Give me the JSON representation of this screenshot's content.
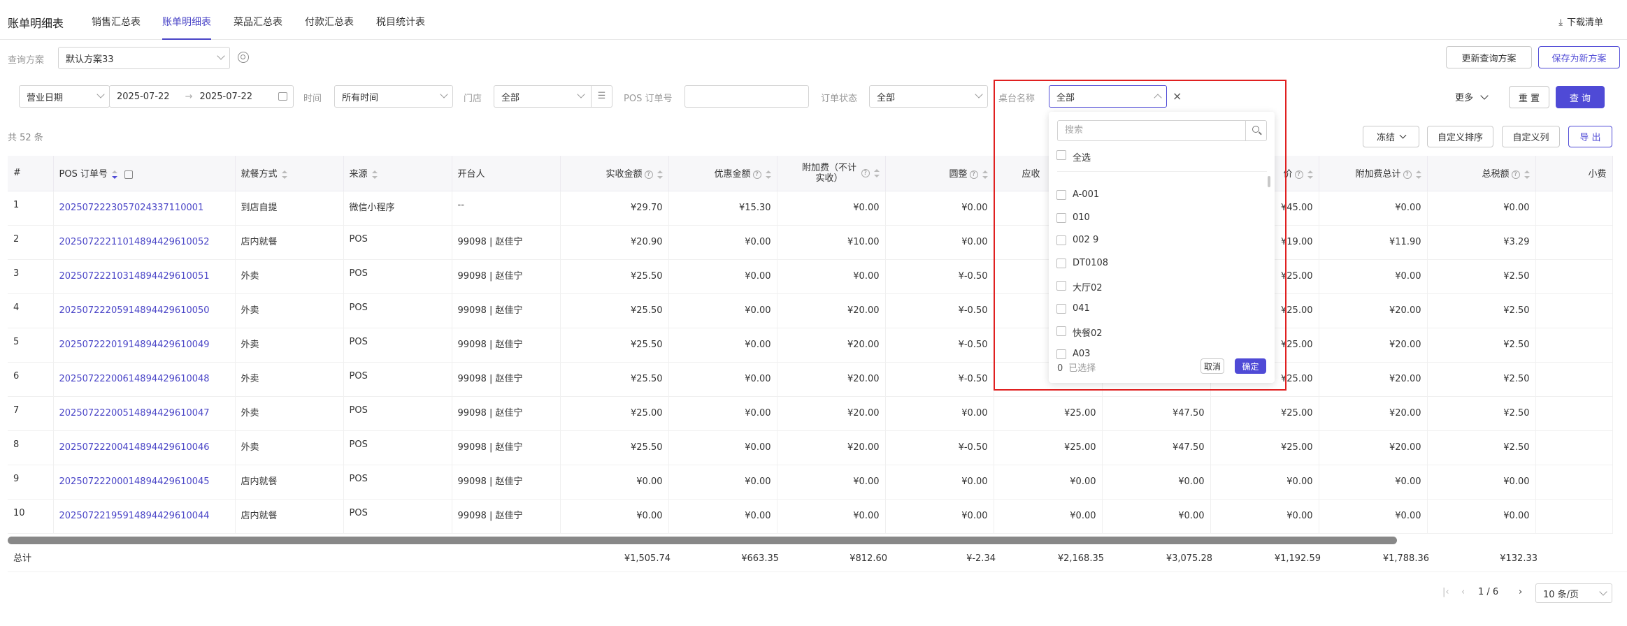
{
  "header": {
    "page_title": "账单明细表",
    "tabs": [
      {
        "label": "销售汇总表"
      },
      {
        "label": "账单明细表"
      },
      {
        "label": "菜品汇总表"
      },
      {
        "label": "付款汇总表"
      },
      {
        "label": "税目统计表"
      }
    ],
    "download_label": "下载清单"
  },
  "query_plan": {
    "label": "查询方案",
    "value": "默认方案33",
    "update_btn": "更新查询方案",
    "save_btn": "保存为新方案"
  },
  "filters": {
    "date_type": "营业日期",
    "date_start": "2025-07-22",
    "date_arrow": "→",
    "date_end": "2025-07-22",
    "time_label": "时间",
    "time_value": "所有时间",
    "store_label": "门店",
    "store_value": "全部",
    "order_label": "POS 订单号",
    "order_placeholder": "",
    "status_label": "订单状态",
    "status_value": "全部",
    "table_label": "桌台名称",
    "table_value": "全部",
    "more": "更多",
    "reset": "重 置",
    "query": "查 询"
  },
  "summary": {
    "count_text": "共 52 条"
  },
  "toolbar": {
    "freeze": "冻结",
    "custom_sort": "自定义排序",
    "custom_cols": "自定义列",
    "export": "导 出"
  },
  "columns": [
    "#",
    "POS 订单号",
    "就餐方式",
    "来源",
    "开台人",
    "实收金额",
    "优惠金额",
    "附加费（不计实收）",
    "圆整",
    "应收",
    "",
    "价",
    "附加费总计",
    "总税额",
    "小费"
  ],
  "rows": [
    {
      "n": "1",
      "order": "20250722230570243371100​01",
      "dine": "到店自提",
      "src": "微信小程序",
      "opener": "--",
      "paid": "¥29.70",
      "disc": "¥15.30",
      "sur": "¥0.00",
      "round": "¥0.00",
      "c10": "",
      "c11": "",
      "price": "¥45.00",
      "surtotal": "¥0.00",
      "tax": "¥0.00"
    },
    {
      "n": "2",
      "order": "20250722211014894429610052",
      "dine": "店内就餐",
      "src": "POS",
      "opener": "99098 | 赵佳宁",
      "paid": "¥20.90",
      "disc": "¥0.00",
      "sur": "¥10.00",
      "round": "¥0.00",
      "c10": "",
      "c11": "",
      "price": "¥19.00",
      "surtotal": "¥11.90",
      "tax": "¥3.29"
    },
    {
      "n": "3",
      "order": "20250722210314894429610051",
      "dine": "外卖",
      "src": "POS",
      "opener": "99098 | 赵佳宁",
      "paid": "¥25.50",
      "disc": "¥0.00",
      "sur": "¥0.00",
      "round": "¥-0.50",
      "c10": "",
      "c11": "",
      "price": "¥25.00",
      "surtotal": "¥0.00",
      "tax": "¥2.50"
    },
    {
      "n": "4",
      "order": "20250722205914894429610050",
      "dine": "外卖",
      "src": "POS",
      "opener": "99098 | 赵佳宁",
      "paid": "¥25.50",
      "disc": "¥0.00",
      "sur": "¥20.00",
      "round": "¥-0.50",
      "c10": "",
      "c11": "",
      "price": "¥25.00",
      "surtotal": "¥20.00",
      "tax": "¥2.50"
    },
    {
      "n": "5",
      "order": "20250722201914894429610049",
      "dine": "外卖",
      "src": "POS",
      "opener": "99098 | 赵佳宁",
      "paid": "¥25.50",
      "disc": "¥0.00",
      "sur": "¥20.00",
      "round": "¥-0.50",
      "c10": "",
      "c11": "",
      "price": "¥25.00",
      "surtotal": "¥20.00",
      "tax": "¥2.50"
    },
    {
      "n": "6",
      "order": "20250722200614894429610048",
      "dine": "外卖",
      "src": "POS",
      "opener": "99098 | 赵佳宁",
      "paid": "¥25.50",
      "disc": "¥0.00",
      "sur": "¥20.00",
      "round": "¥-0.50",
      "c10": "",
      "c11": "",
      "price": "¥25.00",
      "surtotal": "¥20.00",
      "tax": "¥2.50"
    },
    {
      "n": "7",
      "order": "20250722200514894429610047",
      "dine": "外卖",
      "src": "POS",
      "opener": "99098 | 赵佳宁",
      "paid": "¥25.00",
      "disc": "¥0.00",
      "sur": "¥20.00",
      "round": "¥0.00",
      "c10": "¥25.00",
      "c11": "¥47.50",
      "price": "¥25.00",
      "surtotal": "¥20.00",
      "tax": "¥2.50"
    },
    {
      "n": "8",
      "order": "20250722200414894429610046",
      "dine": "外卖",
      "src": "POS",
      "opener": "99098 | 赵佳宁",
      "paid": "¥25.50",
      "disc": "¥0.00",
      "sur": "¥20.00",
      "round": "¥-0.50",
      "c10": "¥25.00",
      "c11": "¥47.50",
      "price": "¥25.00",
      "surtotal": "¥20.00",
      "tax": "¥2.50"
    },
    {
      "n": "9",
      "order": "20250722200014894429610045",
      "dine": "店内就餐",
      "src": "POS",
      "opener": "99098 | 赵佳宁",
      "paid": "¥0.00",
      "disc": "¥0.00",
      "sur": "¥0.00",
      "round": "¥0.00",
      "c10": "¥0.00",
      "c11": "¥0.00",
      "price": "¥0.00",
      "surtotal": "¥0.00",
      "tax": "¥0.00"
    },
    {
      "n": "10",
      "order": "20250722195914894429610044",
      "dine": "店内就餐",
      "src": "POS",
      "opener": "99098 | 赵佳宁",
      "paid": "¥0.00",
      "disc": "¥0.00",
      "sur": "¥0.00",
      "round": "¥0.00",
      "c10": "¥0.00",
      "c11": "¥0.00",
      "price": "¥0.00",
      "surtotal": "¥0.00",
      "tax": "¥0.00"
    }
  ],
  "totals": {
    "label": "总计",
    "paid": "¥1,505.74",
    "disc": "¥663.35",
    "sur": "¥812.60",
    "round": "¥-2.34",
    "c10": "¥2,168.35",
    "c11": "¥3,075.28",
    "price": "¥1,192.59",
    "surtotal": "¥1,788.36",
    "tax": "¥132.33"
  },
  "pagination": {
    "page_text": "1 / 6",
    "page_size": "10 条/页"
  },
  "dropdown": {
    "search_placeholder": "搜索",
    "select_all": "全选",
    "options": [
      "A-001",
      "010",
      "002 9",
      "DT0108",
      "大厅02",
      "041",
      "快餐02",
      "A03"
    ],
    "selected_count": "0",
    "selected_label": "已选择",
    "cancel": "取消",
    "confirm": "确定"
  },
  "colors": {
    "accent": "#4f4ad6",
    "highlight_border": "#e02020"
  }
}
